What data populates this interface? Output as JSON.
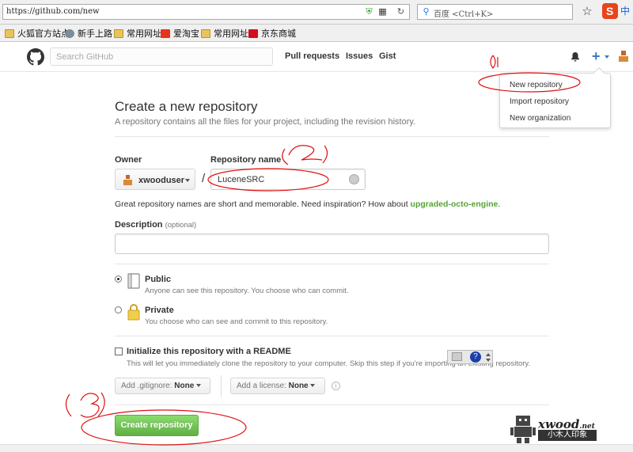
{
  "browser": {
    "url": "https://github.com/new",
    "search_placeholder": "百度 <Ctrl+K>",
    "ime_label": "中"
  },
  "bookmarks": [
    {
      "label": "火狐官方站点",
      "icon": "folder-icon"
    },
    {
      "label": "新手上路",
      "icon": "globe-icon"
    },
    {
      "label": "常用网址",
      "icon": "folder-icon"
    },
    {
      "label": "爱淘宝",
      "icon": "taobao-icon"
    },
    {
      "label": "常用网址",
      "icon": "folder-icon"
    },
    {
      "label": "京东商城",
      "icon": "jd-icon"
    }
  ],
  "header": {
    "search_placeholder": "Search GitHub",
    "nav": [
      "Pull requests",
      "Issues",
      "Gist"
    ],
    "plus_label": "+"
  },
  "dropdown": {
    "items": [
      "New repository",
      "Import repository",
      "New organization"
    ]
  },
  "page": {
    "title": "Create a new repository",
    "subtitle": "A repository contains all the files for your project, including the revision history.",
    "owner_label": "Owner",
    "owner_value": "xwooduser",
    "repo_label": "Repository name",
    "repo_value": "LuceneSRC",
    "hint_prefix": "Great repository names are short and memorable. Need inspiration? How about",
    "hint_suggestion": "upgraded-octo-engine",
    "hint_suffix": ".",
    "desc_label": "Description",
    "desc_optional": "(optional)",
    "public_title": "Public",
    "public_desc": "Anyone can see this repository. You choose who can commit.",
    "private_title": "Private",
    "private_desc": "You choose who can see and commit to this repository.",
    "readme_title": "Initialize this repository with a README",
    "readme_desc": "This will let you immediately clone the repository to your computer. Skip this step if you're importing an existing repository.",
    "gitignore_prefix": "Add .gitignore:",
    "gitignore_value": "None",
    "license_prefix": "Add a license:",
    "license_value": "None",
    "create_button": "Create repository"
  },
  "annotations": [
    "1",
    "2",
    "3"
  ],
  "watermark": {
    "text": "xwood",
    "suffix": ".net",
    "sub": "小木人印象"
  },
  "colors": {
    "accent": "#4078c0",
    "green": "#60b044",
    "annotation": "#e01010"
  }
}
